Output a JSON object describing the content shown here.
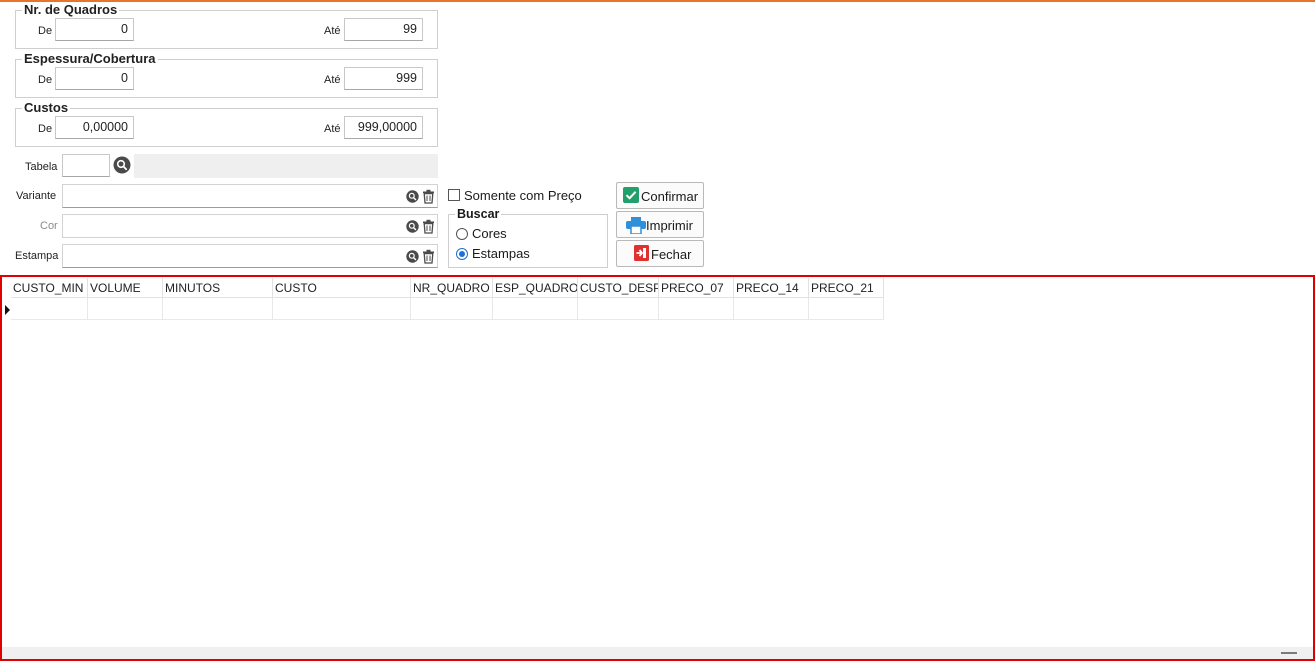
{
  "nr_quadros": {
    "title": "Nr. de Quadros",
    "de_label": "De",
    "de_value": "0",
    "ate_label": "Até",
    "ate_value": "99"
  },
  "espessura": {
    "title": "Espessura/Cobertura",
    "de_label": "De",
    "de_value": "0",
    "ate_label": "Até",
    "ate_value": "999"
  },
  "custos": {
    "title": "Custos",
    "de_label": "De",
    "de_value": "0,00000",
    "ate_label": "Até",
    "ate_value": "999,00000"
  },
  "tabela": {
    "label": "Tabela",
    "code": "",
    "description": ""
  },
  "variante": {
    "label": "Variante",
    "value": ""
  },
  "cor": {
    "label": "Cor",
    "value": ""
  },
  "estampa": {
    "label": "Estampa",
    "value": ""
  },
  "somente_preco": {
    "label": "Somente com Preço",
    "checked": false
  },
  "buscar": {
    "title": "Buscar",
    "options": [
      {
        "label": "Cores",
        "selected": false
      },
      {
        "label": "Estampas",
        "selected": true
      }
    ]
  },
  "buttons": {
    "confirmar": "Confirmar",
    "imprimir": "Imprimir",
    "fechar": "Fechar"
  },
  "grid": {
    "columns": [
      "CUSTO_MIN",
      "VOLUME",
      "MINUTOS",
      "CUSTO",
      "NR_QUADRO",
      "ESP_QUADRO",
      "CUSTO_DESP",
      "PRECO_07",
      "PRECO_14",
      "PRECO_21"
    ],
    "rows": []
  },
  "colors": {
    "accent": "#e8742a",
    "highlight": "#e00000",
    "radio": "#1d6fd6",
    "confirm_icon": "#22a06b",
    "print_icon": "#2f8fd8",
    "close_icon": "#e03131"
  }
}
